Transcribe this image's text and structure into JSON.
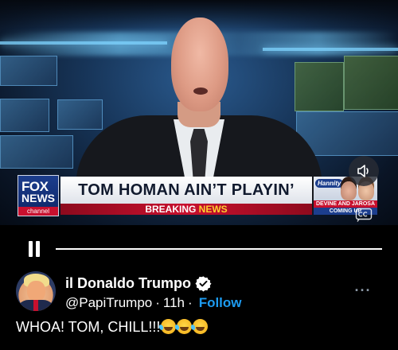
{
  "video": {
    "chyron": {
      "network_word": "FOX",
      "network_sub": "NEWS",
      "channel_word": "channel",
      "headline": "TOM HOMAN AIN’T PLAYIN’",
      "breaking_prefix": "BREAKING",
      "breaking_suffix": "NEWS",
      "promo_brand": "Hannity",
      "promo_line": "DEVINE AND JAROSA",
      "promo_sub": "COMING UP"
    },
    "progress_fraction": 1.0
  },
  "tweet": {
    "display_name": "il Donaldo Trumpo",
    "handle": "@PapiTrumpo",
    "separator": "·",
    "time": "11h",
    "follow_label": "Follow",
    "text": "WHOA! TOM, CHILL!!!",
    "emoji": [
      "rolling-on-floor-laughing",
      "rolling-on-floor-laughing",
      "rolling-on-floor-laughing"
    ],
    "more_label": "···"
  },
  "colors": {
    "background": "#000000",
    "accent_blue": "#1d9bf0",
    "fox_red": "#c8102e",
    "fox_blue": "#1c3e8d"
  }
}
